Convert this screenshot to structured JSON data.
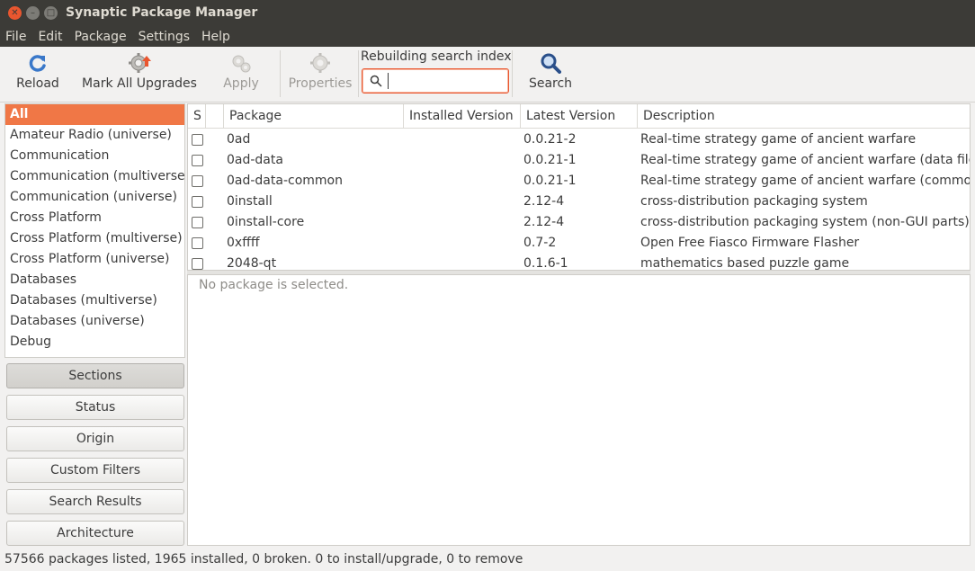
{
  "window": {
    "title": "Synaptic Package Manager"
  },
  "menu": [
    "File",
    "Edit",
    "Package",
    "Settings",
    "Help"
  ],
  "toolbar": {
    "reload_label": "Reload",
    "mark_all_upgrades_label": "Mark All Upgrades",
    "apply_label": "Apply",
    "properties_label": "Properties",
    "search_caption": "Rebuilding search index",
    "search_value": "",
    "search_label": "Search"
  },
  "categories": [
    "All",
    "Amateur Radio (universe)",
    "Communication",
    "Communication (multiverse)",
    "Communication (universe)",
    "Cross Platform",
    "Cross Platform (multiverse)",
    "Cross Platform (universe)",
    "Databases",
    "Databases (multiverse)",
    "Databases (universe)",
    "Debug"
  ],
  "filters": [
    "Sections",
    "Status",
    "Origin",
    "Custom Filters",
    "Search Results",
    "Architecture"
  ],
  "table": {
    "columns": [
      "S",
      "Package",
      "Installed Version",
      "Latest Version",
      "Description"
    ],
    "rows": [
      {
        "package": "0ad",
        "installed": "",
        "latest": "0.0.21-2",
        "description": "Real-time strategy game of ancient warfare"
      },
      {
        "package": "0ad-data",
        "installed": "",
        "latest": "0.0.21-1",
        "description": "Real-time strategy game of ancient warfare (data files"
      },
      {
        "package": "0ad-data-common",
        "installed": "",
        "latest": "0.0.21-1",
        "description": "Real-time strategy game of ancient warfare (common"
      },
      {
        "package": "0install",
        "installed": "",
        "latest": "2.12-4",
        "description": "cross-distribution packaging system"
      },
      {
        "package": "0install-core",
        "installed": "",
        "latest": "2.12-4",
        "description": "cross-distribution packaging system (non-GUI parts)"
      },
      {
        "package": "0xffff",
        "installed": "",
        "latest": "0.7-2",
        "description": "Open Free Fiasco Firmware Flasher"
      },
      {
        "package": "2048-qt",
        "installed": "",
        "latest": "0.1.6-1",
        "description": "mathematics based puzzle game"
      }
    ]
  },
  "detail": {
    "message": "No package is selected."
  },
  "status": "57566 packages listed, 1965 installed, 0 broken. 0 to install/upgrade, 0 to remove",
  "colors": {
    "accent": "#f07746",
    "titlebar": "#3c3b37"
  }
}
